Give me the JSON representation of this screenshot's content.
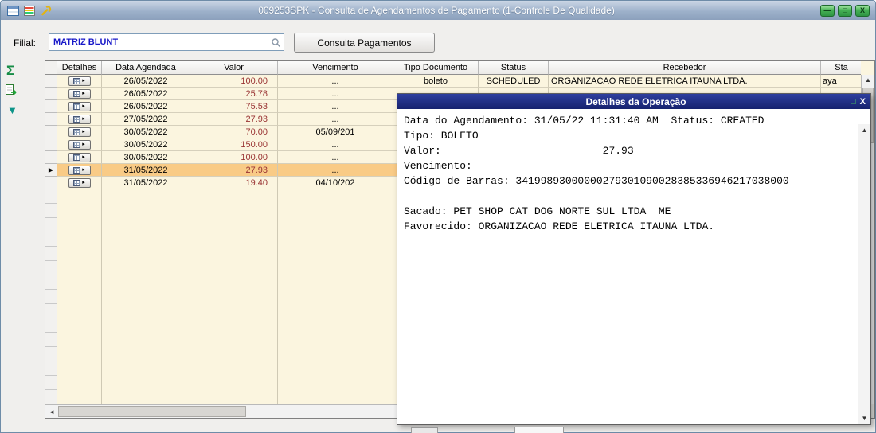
{
  "window": {
    "title": "009253SPK - Consulta de Agendamentos de Pagamento (1-Controle De Qualidade)",
    "controls": {
      "minimize": "—",
      "maximize": "□",
      "close": "X"
    }
  },
  "toolbar": {
    "filial_label": "Filial:",
    "filial_value": "MATRIZ BLUNT",
    "consulta_button_label": "Consulta Pagamentos"
  },
  "side_toolbar": {
    "sum_icon": "Σ",
    "filter_icon": "▼"
  },
  "grid": {
    "columns": [
      "Detalhes",
      "Data Agendada",
      "Valor",
      "Vencimento",
      "Tipo Documento",
      "Status",
      "Recebedor",
      "Sta"
    ],
    "rows": [
      {
        "data_agendada": "26/05/2022",
        "valor": "100.00",
        "vencimento": "...",
        "tipo_documento": "boleto",
        "status": "SCHEDULED",
        "recebedor": "ORGANIZACAO REDE ELETRICA ITAUNA LTDA.",
        "sta": "aya",
        "selected": false
      },
      {
        "data_agendada": "26/05/2022",
        "valor": "25.78",
        "vencimento": "...",
        "tipo_documento": "",
        "status": "",
        "recebedor": "",
        "sta": "",
        "selected": false
      },
      {
        "data_agendada": "26/05/2022",
        "valor": "75.53",
        "vencimento": "...",
        "tipo_documento": "",
        "status": "",
        "recebedor": "",
        "sta": "",
        "selected": false
      },
      {
        "data_agendada": "27/05/2022",
        "valor": "27.93",
        "vencimento": "...",
        "tipo_documento": "",
        "status": "",
        "recebedor": "",
        "sta": "",
        "selected": false
      },
      {
        "data_agendada": "30/05/2022",
        "valor": "70.00",
        "vencimento": "05/09/201",
        "tipo_documento": "",
        "status": "",
        "recebedor": "",
        "sta": "",
        "selected": false
      },
      {
        "data_agendada": "30/05/2022",
        "valor": "150.00",
        "vencimento": "...",
        "tipo_documento": "",
        "status": "",
        "recebedor": "",
        "sta": "",
        "selected": false
      },
      {
        "data_agendada": "30/05/2022",
        "valor": "100.00",
        "vencimento": "...",
        "tipo_documento": "",
        "status": "",
        "recebedor": "",
        "sta": "",
        "selected": false
      },
      {
        "data_agendada": "31/05/2022",
        "valor": "27.93",
        "vencimento": "...",
        "tipo_documento": "",
        "status": "",
        "recebedor": "",
        "sta": "",
        "selected": true
      },
      {
        "data_agendada": "31/05/2022",
        "valor": "19.40",
        "vencimento": "04/10/202",
        "tipo_documento": "",
        "status": "",
        "recebedor": "",
        "sta": "",
        "selected": false
      }
    ],
    "empty_rows": 15
  },
  "dialog": {
    "title": "Detalhes da Operação",
    "controls": {
      "maximize": "□",
      "close": "X"
    },
    "lines": [
      "Data do Agendamento: 31/05/22 11:31:40 AM  Status: CREATED",
      "Tipo: BOLETO",
      "Valor:                          27.93",
      "Vencimento:",
      "Código de Barras: 34199893000000279301090028385336946217038000",
      "",
      "Sacado: PET SHOP CAT DOG NORTE SUL LTDA  ME",
      "Favorecido: ORGANIZACAO REDE ELETRICA ITAUNA LTDA."
    ]
  },
  "colors": {
    "row_bg": "#FBF5DF",
    "selected_row_bg": "#F9CB86",
    "dialog_titlebar": "#16226E",
    "valor_text": "#993333"
  }
}
